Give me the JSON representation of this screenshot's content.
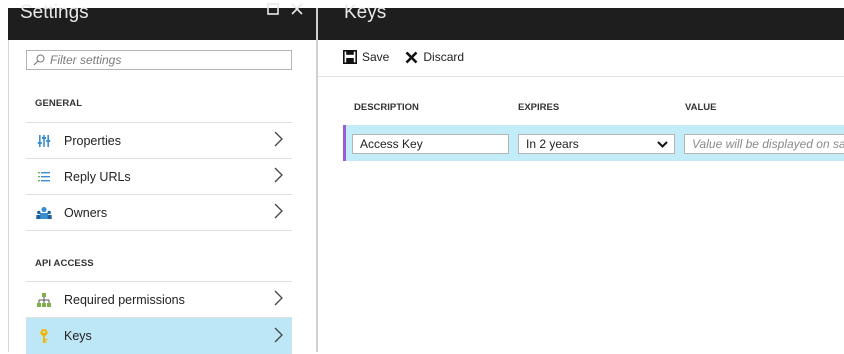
{
  "left_panel": {
    "title": "Settings",
    "filter_placeholder": "Filter settings",
    "sections": [
      {
        "heading": "GENERAL",
        "items": [
          {
            "label": "Properties",
            "icon": "properties-icon"
          },
          {
            "label": "Reply URLs",
            "icon": "list-icon"
          },
          {
            "label": "Owners",
            "icon": "users-icon"
          }
        ]
      },
      {
        "heading": "API ACCESS",
        "items": [
          {
            "label": "Required permissions",
            "icon": "permissions-icon"
          },
          {
            "label": "Keys",
            "icon": "key-icon",
            "selected": true
          }
        ]
      }
    ]
  },
  "right_panel": {
    "title": "Keys",
    "toolbar": {
      "save_label": "Save",
      "discard_label": "Discard"
    },
    "table": {
      "headers": [
        "DESCRIPTION",
        "EXPIRES",
        "VALUE"
      ],
      "row": {
        "description": "Access Key",
        "expires": "In 2 years",
        "value_placeholder": "Value will be displayed on sa"
      }
    }
  },
  "colors": {
    "selected_bg": "#bde6f7",
    "row_bg": "#c3ecf9",
    "row_accent": "#9b5bd4",
    "header_bg": "#1e1e1e"
  }
}
